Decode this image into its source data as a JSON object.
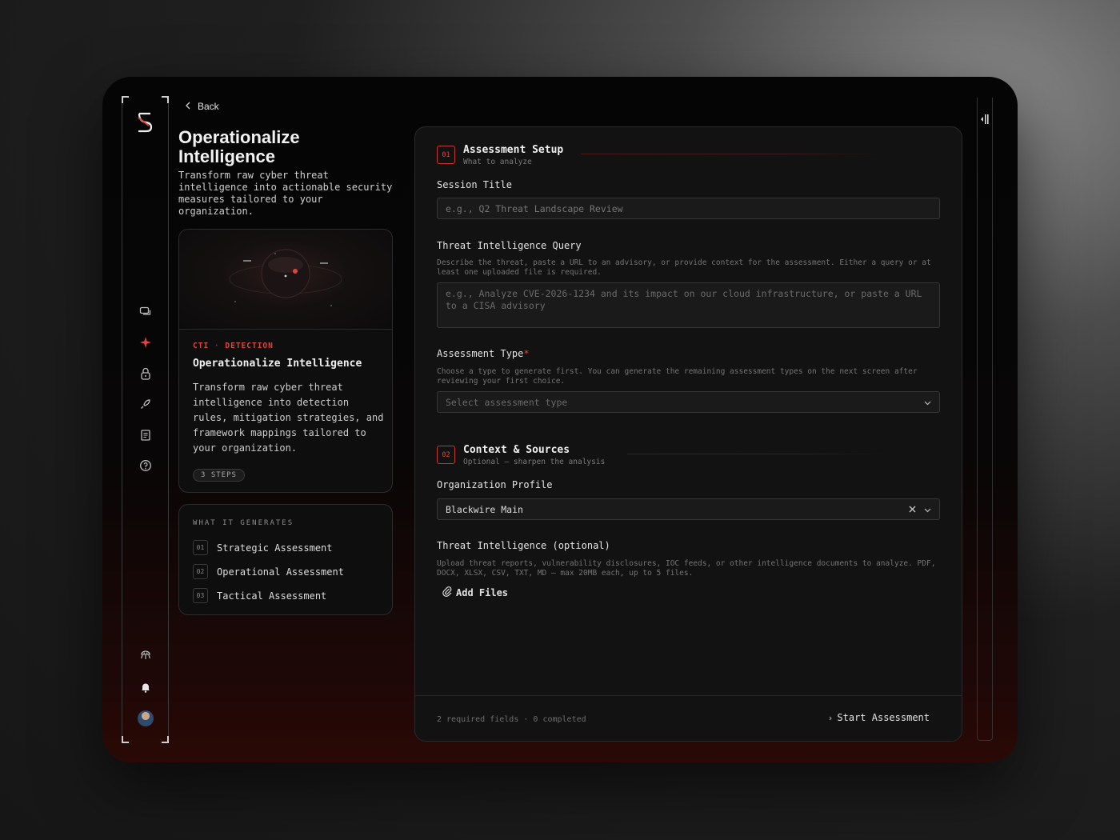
{
  "nav": {
    "back_label": "Back"
  },
  "page": {
    "title": "Operationalize Intelligence",
    "description": "Transform raw cyber threat intelligence into actionable security measures tailored to your organization."
  },
  "card": {
    "tag_primary": "CTI",
    "tag_separator": "·",
    "tag_secondary": "DETECTION",
    "title": "Operationalize Intelligence",
    "description": "Transform raw cyber threat intelligence into detection rules, mitigation strategies, and framework mappings tailored to your organization.",
    "steps_badge": "3 STEPS"
  },
  "generates": {
    "heading": "WHAT IT GENERATES",
    "items": [
      {
        "num": "01",
        "label": "Strategic Assessment"
      },
      {
        "num": "02",
        "label": "Operational Assessment"
      },
      {
        "num": "03",
        "label": "Tactical Assessment"
      }
    ]
  },
  "form": {
    "section1": {
      "num": "01",
      "title": "Assessment Setup",
      "subtitle": "What to analyze"
    },
    "session_title": {
      "label": "Session Title",
      "placeholder": "e.g., Q2 Threat Landscape Review"
    },
    "threat_query": {
      "label": "Threat Intelligence Query",
      "help": "Describe the threat, paste a URL to an advisory, or provide context for the assessment. Either a query or at least one uploaded file is required.",
      "placeholder": "e.g., Analyze CVE-2026-1234 and its impact on our cloud infrastructure, or paste a URL to a CISA advisory"
    },
    "assessment_type": {
      "label": "Assessment Type",
      "required_mark": "*",
      "help": "Choose a type to generate first. You can generate the remaining assessment types on the next screen after reviewing your first choice.",
      "placeholder": "Select assessment type"
    },
    "section2": {
      "num": "02",
      "title": "Context & Sources",
      "subtitle": "Optional — sharpen the analysis"
    },
    "org_profile": {
      "label": "Organization Profile",
      "value": "Blackwire Main"
    },
    "threat_files": {
      "label": "Threat Intelligence (optional)",
      "help": "Upload threat reports, vulnerability disclosures, IOC feeds, or other intelligence documents to analyze. PDF, DOCX, XLSX, CSV, TXT, MD — max 20MB each, up to 5 files.",
      "add_label": "Add Files"
    },
    "footer": {
      "status": "2 required fields · 0 completed",
      "start_label": "Start Assessment"
    }
  },
  "icons": {
    "rail": [
      "logo-icon",
      "chat-icon",
      "sparkle-icon",
      "lock-icon",
      "rocket-icon",
      "document-icon",
      "help-icon",
      "alien-icon",
      "bell-icon"
    ],
    "accent": "#e0443a"
  }
}
